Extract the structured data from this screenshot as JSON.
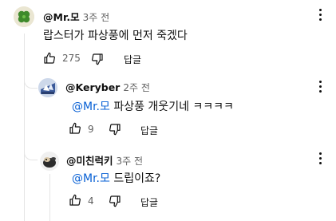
{
  "comments": [
    {
      "author": "@Mr.모",
      "time": "3주 전",
      "text": "랍스터가 파상풍에 먼저 죽겠다",
      "mention": "",
      "likes": "275",
      "reply_label": "답글",
      "avatar_icon": "clover-avatar-icon"
    },
    {
      "author": "@Keryber",
      "time": "2주 전",
      "mention": "@Mr.모",
      "text": " 파상풍 개웃기네 ㅋㅋㅋㅋ",
      "likes": "9",
      "reply_label": "답글",
      "avatar_icon": "anime-avatar-icon"
    },
    {
      "author": "@미친럭키",
      "time": "3주 전",
      "mention": "@Mr.모",
      "text": " 드립이죠?",
      "likes": "4",
      "reply_label": "답글",
      "avatar_icon": "dog-avatar-icon"
    }
  ],
  "colors": {
    "mention": "#065fd4",
    "secondary_text": "#606060",
    "thread_line": "#e5e5e5"
  }
}
